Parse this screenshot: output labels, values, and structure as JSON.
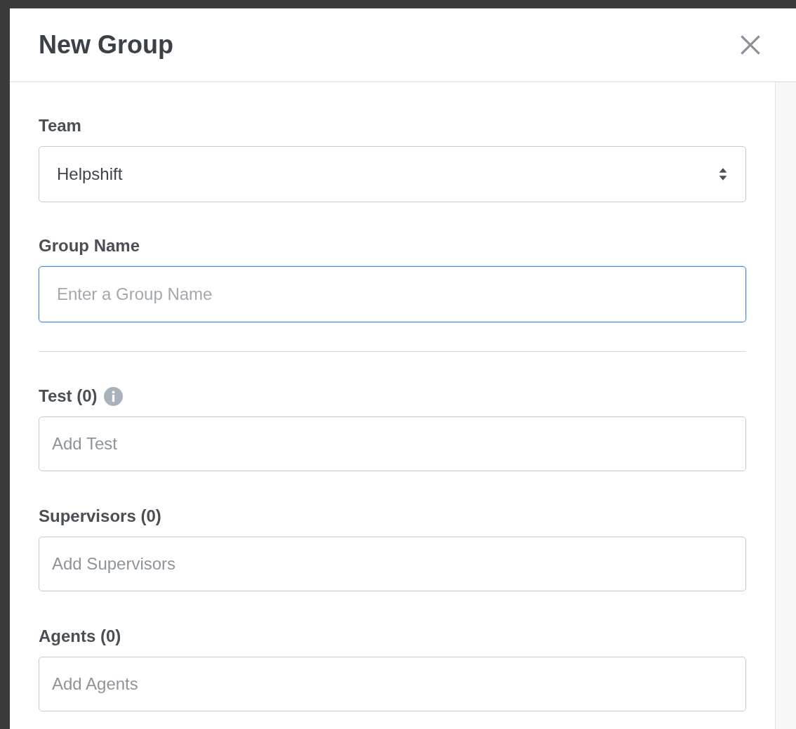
{
  "dialog": {
    "title": "New Group"
  },
  "team": {
    "label": "Team",
    "value": "Helpshift"
  },
  "group_name": {
    "label": "Group Name",
    "placeholder": "Enter a Group Name",
    "focused": true
  },
  "members": [
    {
      "label": "Test (0)",
      "placeholder": "Add Test",
      "info": true
    },
    {
      "label": "Supervisors (0)",
      "placeholder": "Add Supervisors",
      "info": false
    },
    {
      "label": "Agents (0)",
      "placeholder": "Add Agents",
      "info": false
    }
  ]
}
